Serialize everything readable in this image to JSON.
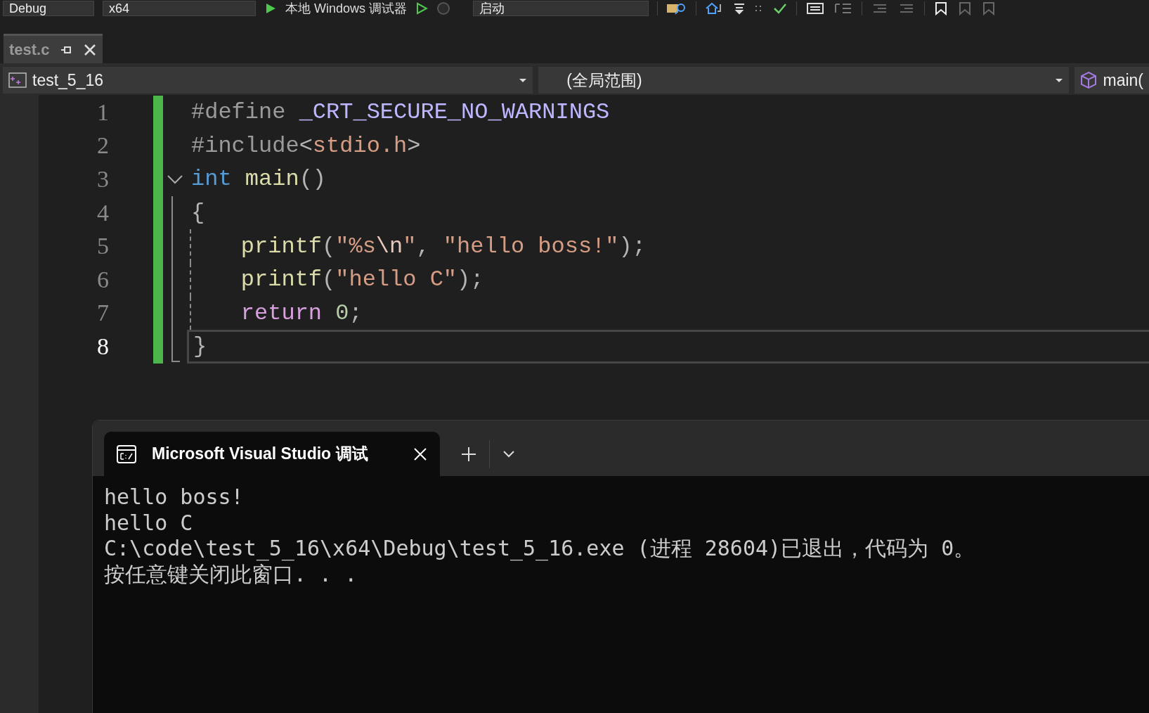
{
  "toolbar": {
    "configuration": "Debug",
    "platform": "x64",
    "debugger": "本地 Windows 调试器",
    "startup": "启动"
  },
  "document_tabs": [
    {
      "label": "test.c",
      "selected": true
    }
  ],
  "navigation_bar": {
    "project": "test_5_16",
    "scope": "(全局范围)",
    "member": "main("
  },
  "code_lines": [
    {
      "number": "1",
      "current": false,
      "foldable": false,
      "in_block": false,
      "indented": false,
      "tokens": [
        {
          "kind": "preprocessor",
          "text": "#define "
        },
        {
          "kind": "macro",
          "text": "_CRT_SECURE_NO_WARNINGS"
        }
      ]
    },
    {
      "number": "2",
      "current": false,
      "foldable": false,
      "in_block": false,
      "indented": false,
      "tokens": [
        {
          "kind": "preprocessor",
          "text": "#include"
        },
        {
          "kind": "punctuation",
          "text": "<"
        },
        {
          "kind": "string",
          "text": "stdio.h"
        },
        {
          "kind": "punctuation",
          "text": ">"
        }
      ]
    },
    {
      "number": "3",
      "current": false,
      "foldable": true,
      "expanded": true,
      "in_block": false,
      "indented": false,
      "tokens": [
        {
          "kind": "keyword",
          "text": "int"
        },
        {
          "kind": "function",
          "text": " main"
        },
        {
          "kind": "punctuation",
          "text": "()"
        }
      ]
    },
    {
      "number": "4",
      "current": false,
      "foldable": false,
      "in_block": true,
      "indented": false,
      "tokens": [
        {
          "kind": "punctuation",
          "text": "{"
        }
      ]
    },
    {
      "number": "5",
      "current": false,
      "foldable": false,
      "in_block": true,
      "indented": true,
      "tokens": [
        {
          "kind": "function",
          "text": "printf"
        },
        {
          "kind": "punctuation",
          "text": "("
        },
        {
          "kind": "string",
          "text": "\"%s"
        },
        {
          "kind": "escape",
          "text": "\\n"
        },
        {
          "kind": "string",
          "text": "\""
        },
        {
          "kind": "punctuation",
          "text": ", "
        },
        {
          "kind": "string",
          "text": "\"hello boss!\""
        },
        {
          "kind": "punctuation",
          "text": ");"
        }
      ]
    },
    {
      "number": "6",
      "current": false,
      "foldable": false,
      "in_block": true,
      "indented": true,
      "tokens": [
        {
          "kind": "function",
          "text": "printf"
        },
        {
          "kind": "punctuation",
          "text": "("
        },
        {
          "kind": "string",
          "text": "\"hello C\""
        },
        {
          "kind": "punctuation",
          "text": ");"
        }
      ]
    },
    {
      "number": "7",
      "current": false,
      "foldable": false,
      "in_block": true,
      "indented": true,
      "tokens": [
        {
          "kind": "control",
          "text": "return"
        },
        {
          "kind": "number",
          "text": " 0"
        },
        {
          "kind": "punctuation",
          "text": ";"
        }
      ]
    },
    {
      "number": "8",
      "current": true,
      "foldable": false,
      "in_block": true,
      "indented": false,
      "tokens": [
        {
          "kind": "punctuation",
          "text": "}"
        }
      ]
    }
  ],
  "terminal": {
    "tabs": [
      {
        "title": "Microsoft Visual Studio 调试",
        "selected": true
      }
    ],
    "output": [
      "hello boss!",
      "hello C",
      "C:\\code\\test_5_16\\x64\\Debug\\test_5_16.exe (进程 28604)已退出，代码为 0。",
      "按任意键关闭此窗口. . ."
    ]
  }
}
